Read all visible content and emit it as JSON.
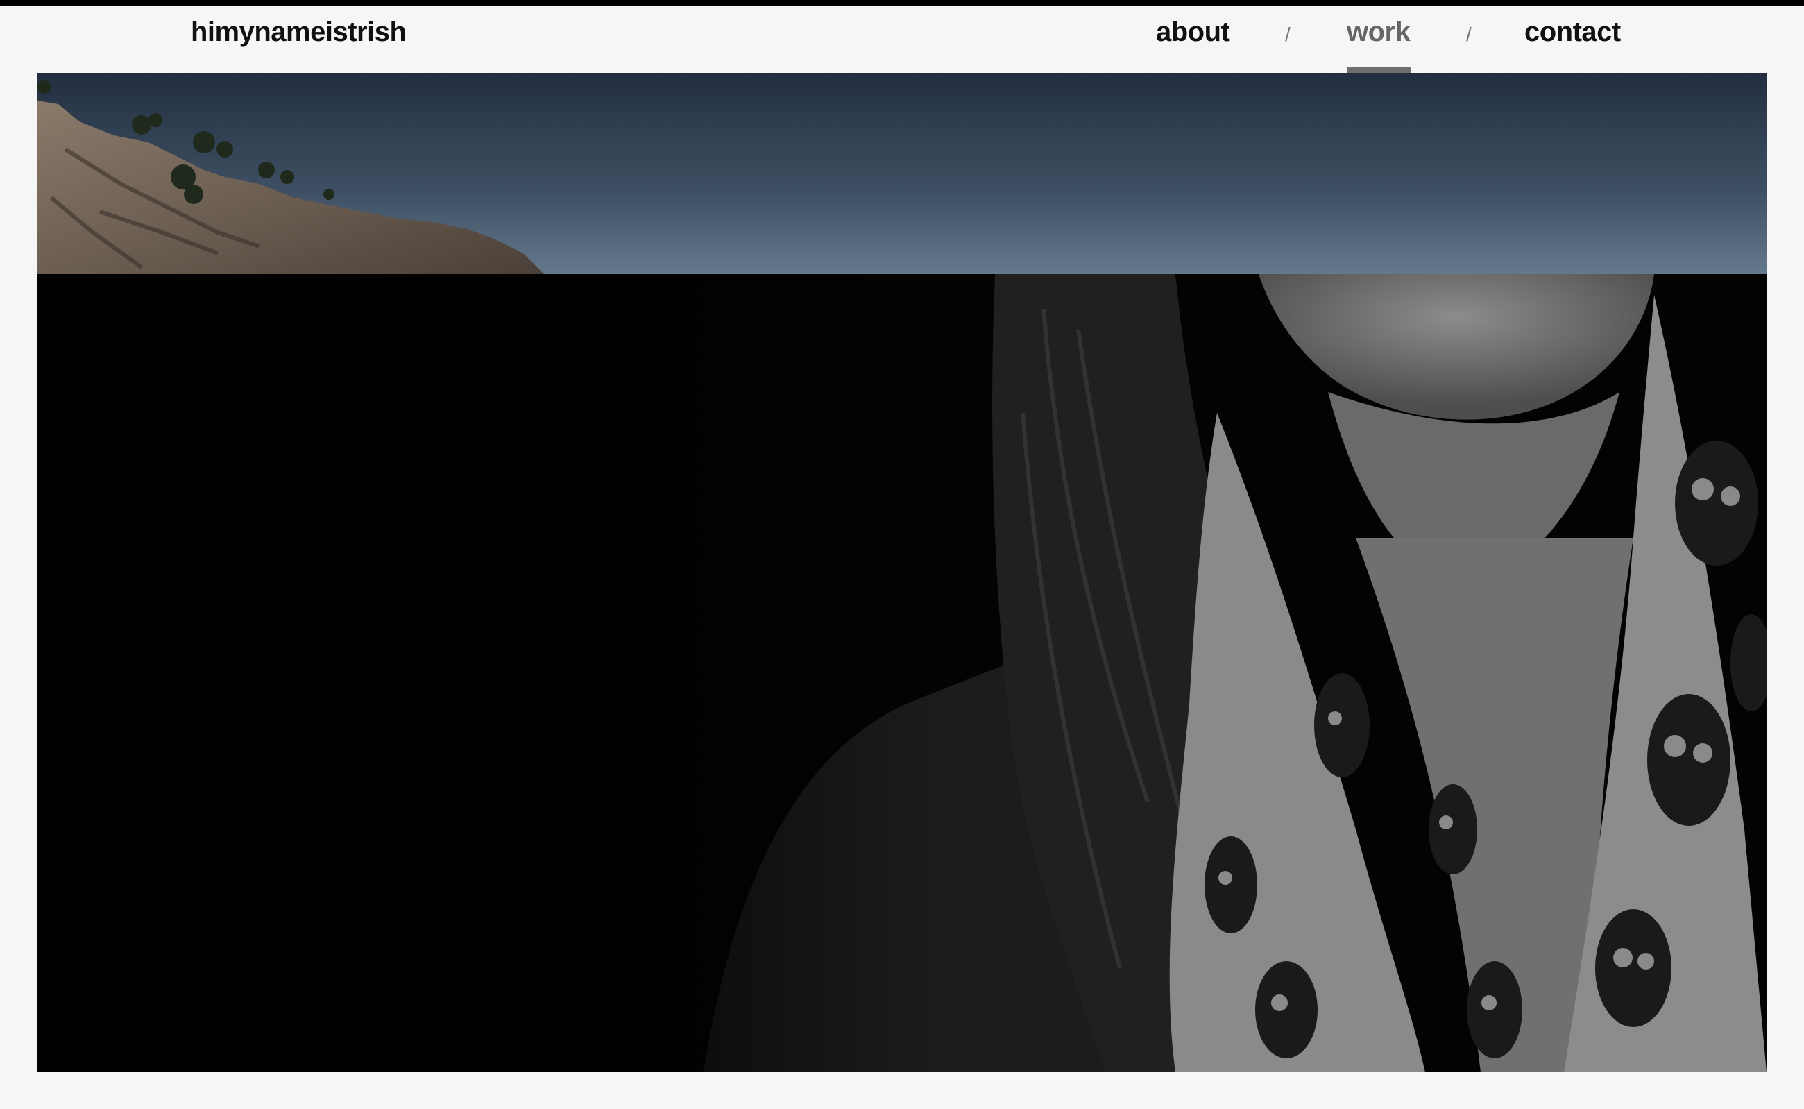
{
  "site": {
    "title": "himynameistrish"
  },
  "nav": {
    "items": [
      {
        "label": "about",
        "active": false
      },
      {
        "label": "work",
        "active": true
      },
      {
        "label": "contact",
        "active": false
      }
    ],
    "separator": "/"
  },
  "hero": {
    "images": [
      {
        "name": "mountain-sky-photo"
      },
      {
        "name": "portrait-photo"
      }
    ]
  },
  "colors": {
    "background": "#f6f6f6",
    "text": "#111111",
    "active_nav": "#666666",
    "topbar": "#000000"
  }
}
